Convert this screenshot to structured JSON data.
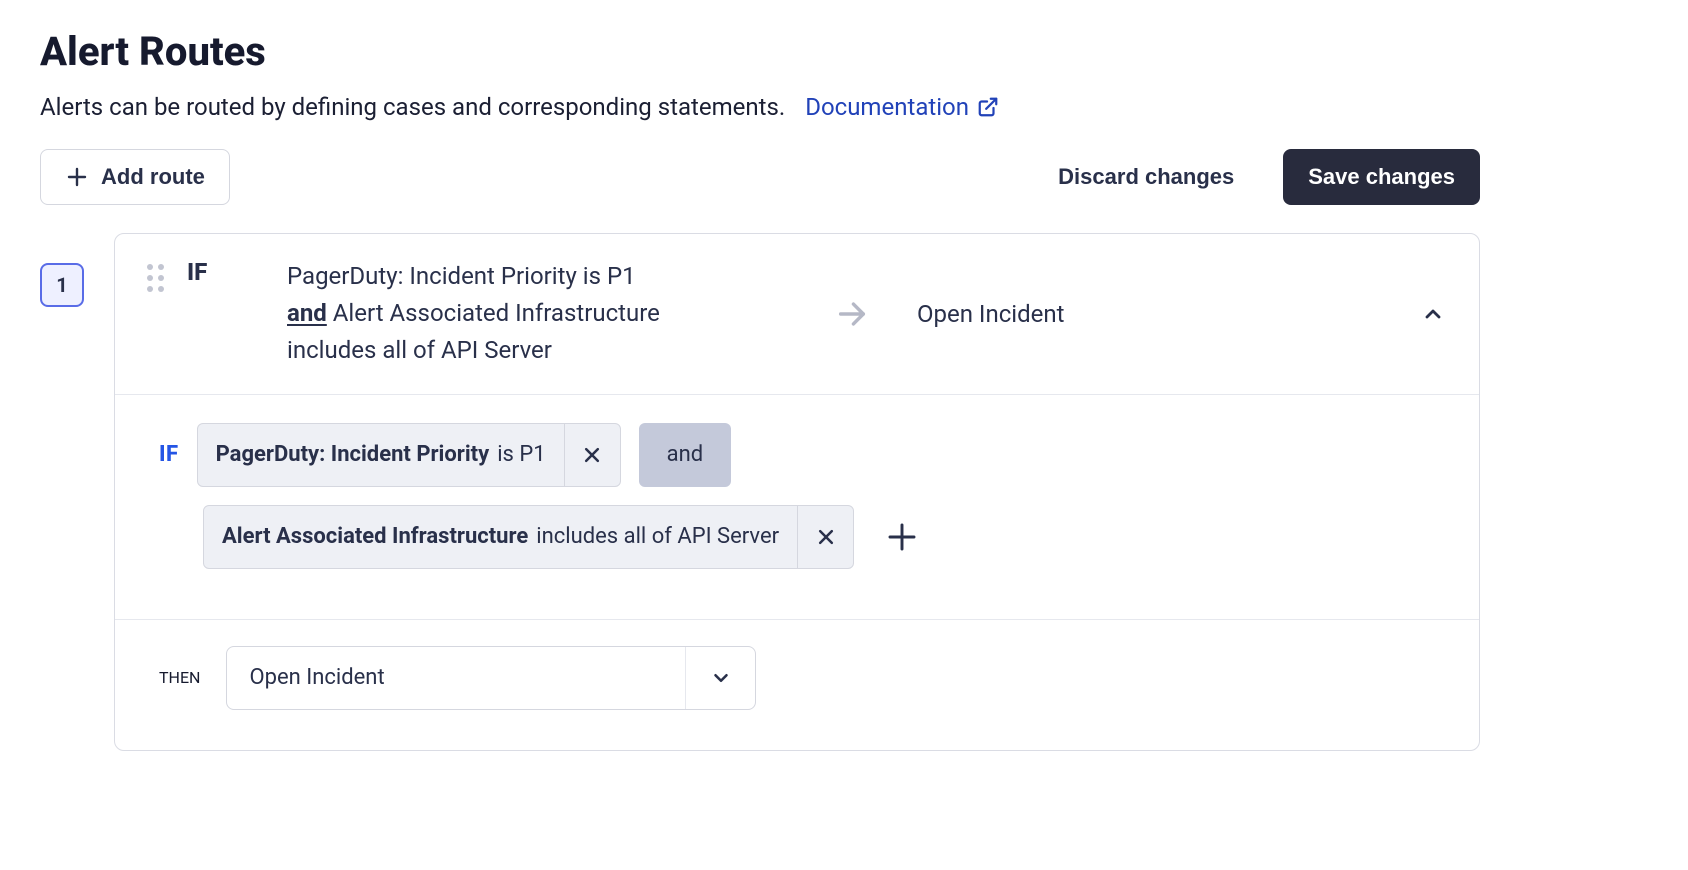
{
  "title": "Alert Routes",
  "subtitle": "Alerts can be routed by defining cases and corresponding statements.",
  "doc_link": "Documentation",
  "buttons": {
    "add_route": "Add route",
    "discard": "Discard changes",
    "save": "Save changes"
  },
  "route": {
    "number": "1",
    "header": {
      "if_label": "IF",
      "cond_line1": "PagerDuty: Incident Priority is P1",
      "cond_and": "and",
      "cond_line2a": " Alert Associated Infrastructure",
      "cond_line3": "includes all of API Server",
      "action": "Open Incident"
    },
    "if_label": "IF",
    "conditions": [
      {
        "field": "PagerDuty: Incident Priority",
        "rest": "is P1"
      },
      {
        "field": "Alert Associated Infrastructure",
        "rest": "includes all of API Server"
      }
    ],
    "operator": "and",
    "then_label": "THEN",
    "then_action": "Open Incident"
  }
}
